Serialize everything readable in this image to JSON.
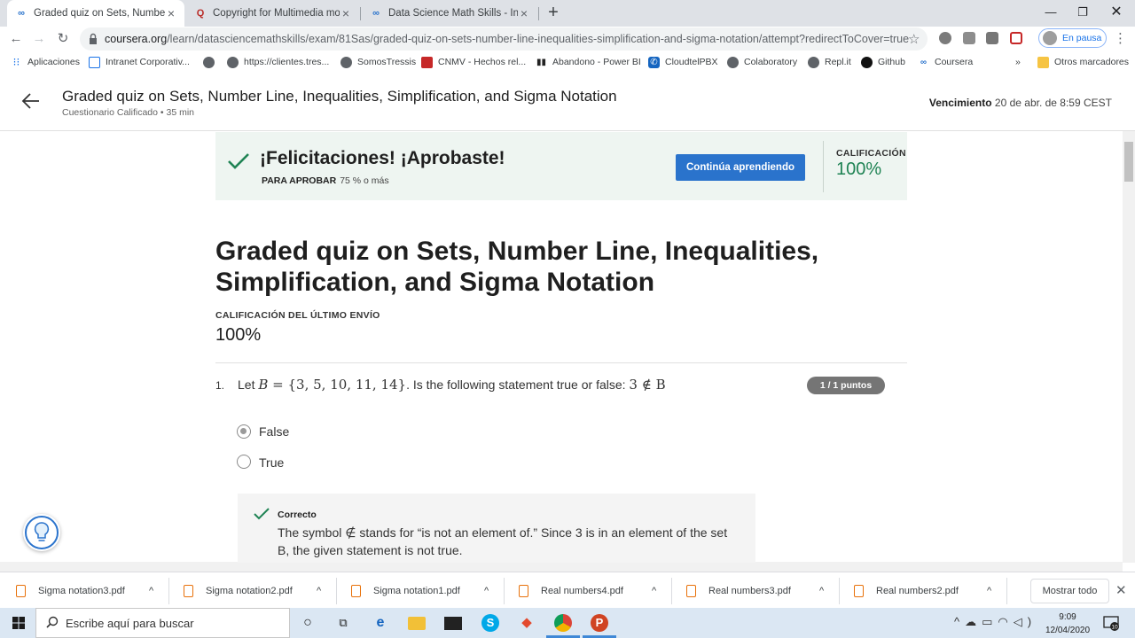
{
  "browser": {
    "tabs": [
      {
        "label": "Graded quiz on Sets, Number Lin",
        "icon": "coursera-icon",
        "active": true
      },
      {
        "label": "Copyright for Multimedia modul",
        "icon": "quora-icon",
        "active": false
      },
      {
        "label": "Data Science Math Skills - Inicio |",
        "icon": "coursera-icon",
        "active": false
      }
    ],
    "new_tab_glyph": "+",
    "url_host": "coursera.org",
    "url_path": "/learn/datasciencemathskills/exam/81Sas/graded-quiz-on-sets-number-line-inequalities-simplification-and-sigma-notation/attempt?redirectToCover=true",
    "profile_label": "En pausa",
    "bookmarks": [
      {
        "label": "Aplicaciones",
        "icon": "apps-grid-icon"
      },
      {
        "label": "Intranet Corporativ...",
        "icon": "page-icon"
      },
      {
        "label": "",
        "icon": "globe-icon"
      },
      {
        "label": "https://clientes.tres...",
        "icon": "globe-icon"
      },
      {
        "label": "SomosTressis",
        "icon": "globe-icon"
      },
      {
        "label": "CNMV - Hechos rel...",
        "icon": "cnmv-icon"
      },
      {
        "label": "Abandono - Power BI",
        "icon": "powerbi-icon"
      },
      {
        "label": "CloudtelPBX",
        "icon": "phone-icon"
      },
      {
        "label": "Colaboratory",
        "icon": "globe-icon"
      },
      {
        "label": "Repl.it",
        "icon": "globe-icon"
      },
      {
        "label": "Github",
        "icon": "github-icon"
      },
      {
        "label": "Coursera",
        "icon": "coursera-icon"
      }
    ],
    "bookmarks_overflow": "»",
    "other_bookmarks": "Otros marcadores"
  },
  "header": {
    "title": "Graded quiz on Sets, Number Line, Inequalities, Simplification, and Sigma Notation",
    "subtitle": "Cuestionario Calificado • 35 min",
    "due_label": "Vencimiento",
    "due_value": "20 de abr. de 8:59 CEST"
  },
  "banner": {
    "heading": "¡Felicitaciones! ¡Aprobaste!",
    "pass_label": "PARA APROBAR",
    "pass_value": "75 % o más",
    "button_label": "Continúa aprendiendo",
    "grade_label": "CALIFICACIÓN",
    "grade_value": "100%"
  },
  "quiz": {
    "title": "Graded quiz on Sets, Number Line, Inequalities, Simplification, and Sigma Notation",
    "last_label": "CALIFICACIÓN DEL ÚLTIMO ENVÍO",
    "last_value": "100%"
  },
  "question": {
    "number": "1.",
    "text_before": "Let ",
    "set_var": "B",
    "set_expr": " = {3, 5, 10, 11, 14}",
    "text_middle": ". Is the following statement true or false: ",
    "statement": "3 ∉ B",
    "points": "1 / 1 puntos",
    "options": [
      {
        "label": "False",
        "selected": true
      },
      {
        "label": "True",
        "selected": false
      }
    ],
    "feedback_title": "Correcto",
    "feedback_line1": "The symbol ∉ stands for “is not an element of.” Since 3 is in an element of the set",
    "feedback_line2": "B, the given statement is not true."
  },
  "downloads": {
    "files": [
      "Sigma notation3.pdf",
      "Sigma notation2.pdf",
      "Sigma notation1.pdf",
      "Real numbers4.pdf",
      "Real numbers3.pdf",
      "Real numbers2.pdf"
    ],
    "show_all": "Mostrar todo"
  },
  "taskbar": {
    "search_placeholder": "Escribe aquí para buscar",
    "time": "9:09",
    "date": "12/04/2020",
    "notification_count": "10"
  },
  "colors": {
    "accent": "#2a73cc",
    "success": "#1f8354",
    "banner_bg": "#eef5f1"
  }
}
